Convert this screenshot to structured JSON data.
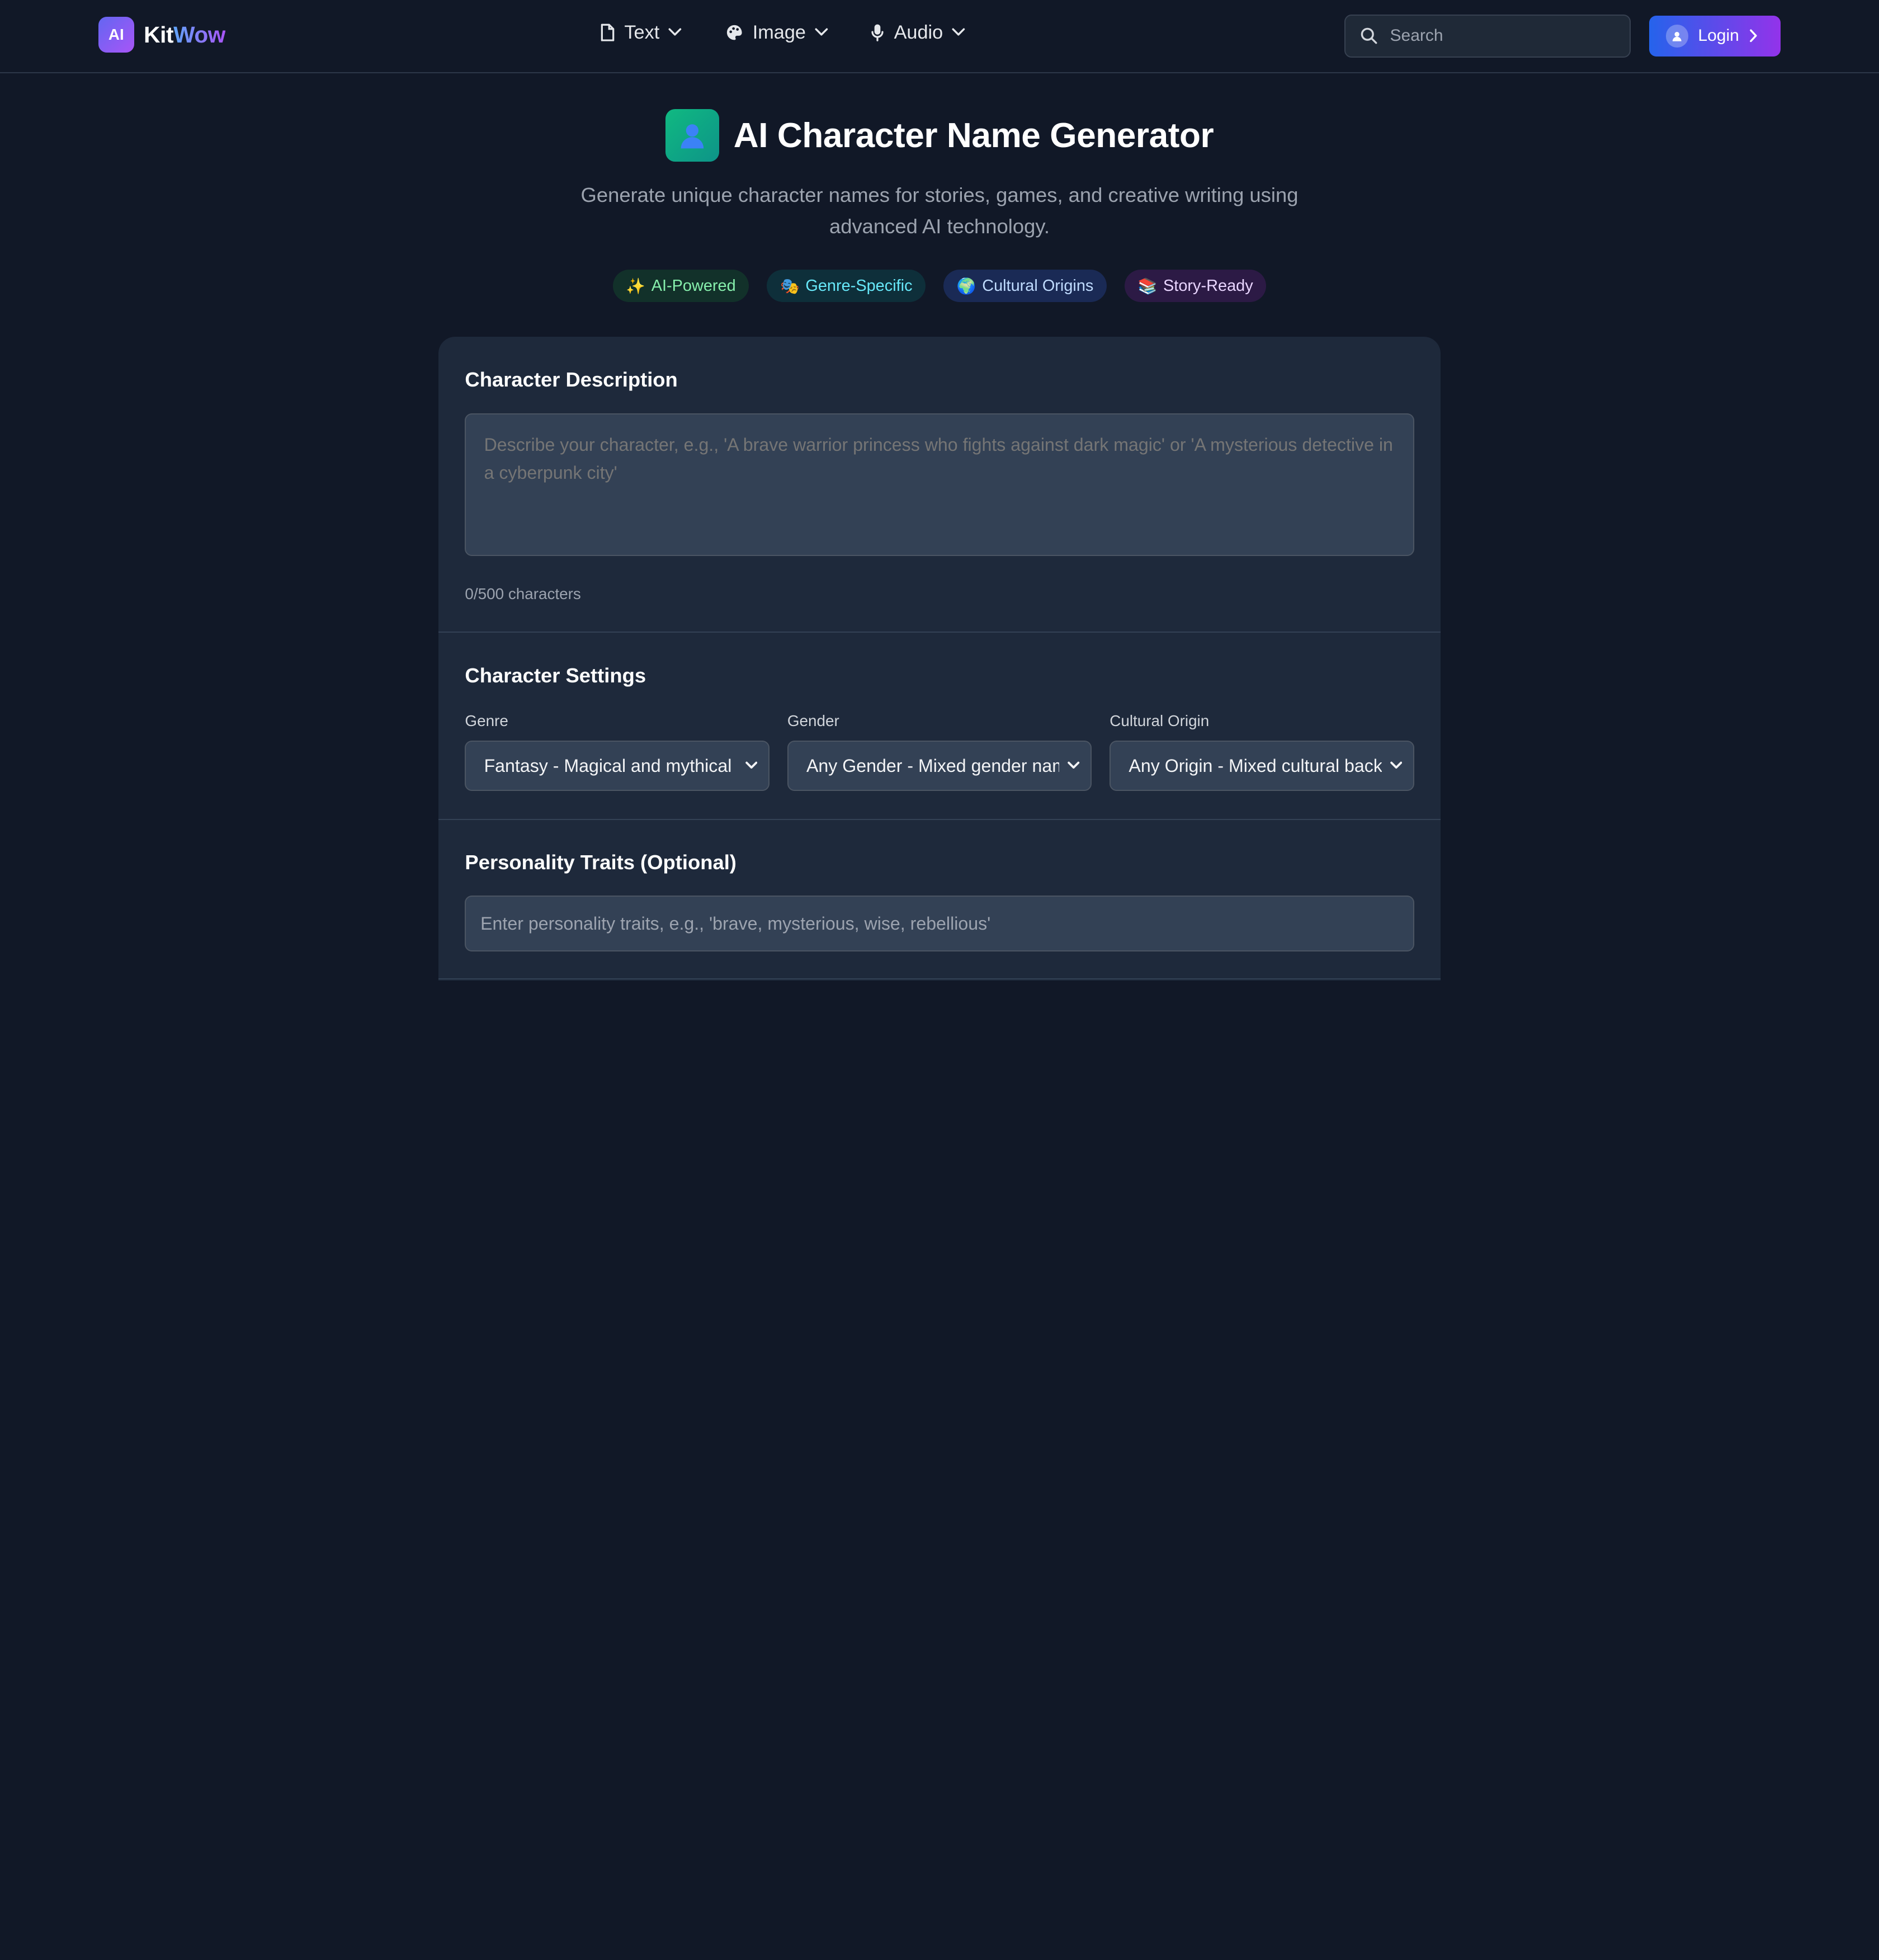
{
  "header": {
    "logo_badge": "AI",
    "logo_part1": "Kit",
    "logo_part2": "Wow",
    "nav": [
      {
        "label": "Text",
        "icon": "document-icon"
      },
      {
        "label": "Image",
        "icon": "palette-icon"
      },
      {
        "label": "Audio",
        "icon": "microphone-icon"
      }
    ],
    "search_placeholder": "Search",
    "login_label": "Login"
  },
  "hero": {
    "title": "AI Character Name Generator",
    "subtitle": "Generate unique character names for stories, games, and creative writing using advanced AI technology.",
    "tags": [
      {
        "emoji": "✨",
        "label": "AI-Powered"
      },
      {
        "emoji": "🎭",
        "label": "Genre-Specific"
      },
      {
        "emoji": "🌍",
        "label": "Cultural Origins"
      },
      {
        "emoji": "📚",
        "label": "Story-Ready"
      }
    ]
  },
  "description": {
    "title": "Character Description",
    "placeholder": "Describe your character, e.g., 'A brave warrior princess who fights against dark magic' or 'A mysterious detective in a cyberpunk city'",
    "counter": "0/500 characters"
  },
  "settings": {
    "title": "Character Settings",
    "genre_label": "Genre",
    "genre_value": "Fantasy - Magical and mythical",
    "gender_label": "Gender",
    "gender_value": "Any Gender - Mixed gender names",
    "origin_label": "Cultural Origin",
    "origin_value": "Any Origin - Mixed cultural backgrounds"
  },
  "traits": {
    "title": "Personality Traits (Optional)",
    "placeholder": "Enter personality traits, e.g., 'brave, mysterious, wise, rebellious'"
  },
  "colors": {
    "background": "#111827",
    "card": "#1e293b",
    "accent_start": "#2563eb",
    "accent_end": "#9333ea"
  }
}
